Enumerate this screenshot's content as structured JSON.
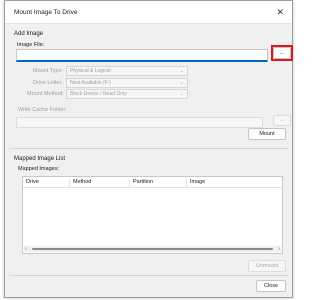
{
  "window": {
    "title": "Mount Image To Drive",
    "close_glyph": "✕"
  },
  "add_image": {
    "group_title": "Add Image",
    "image_file_label": "Image File:",
    "image_file_value": "",
    "browse_label": "...",
    "mount_type_label": "Mount Type:",
    "mount_type_value": "Physical & Logical",
    "drive_letter_label": "Drive Letter:",
    "drive_letter_value": "Next Available (F:)",
    "mount_method_label": "Mount Method:",
    "mount_method_value": "Block Device / Read Only",
    "write_cache_label": "Write Cache Folder:",
    "write_cache_browse_label": "...",
    "mount_button": "Mount",
    "chevron_glyph": "⌄"
  },
  "mapped": {
    "group_title": "Mapped Image List",
    "list_label": "Mapped Images:",
    "columns": [
      "Drive",
      "Method",
      "Partition",
      "Image"
    ],
    "rows": [],
    "scroll_left_glyph": "‹",
    "scroll_right_glyph": "›",
    "unmount_button": "Unmount"
  },
  "footer": {
    "close_button": "Close"
  },
  "colors": {
    "accent": "#0067c0",
    "highlight": "#e0181e"
  }
}
